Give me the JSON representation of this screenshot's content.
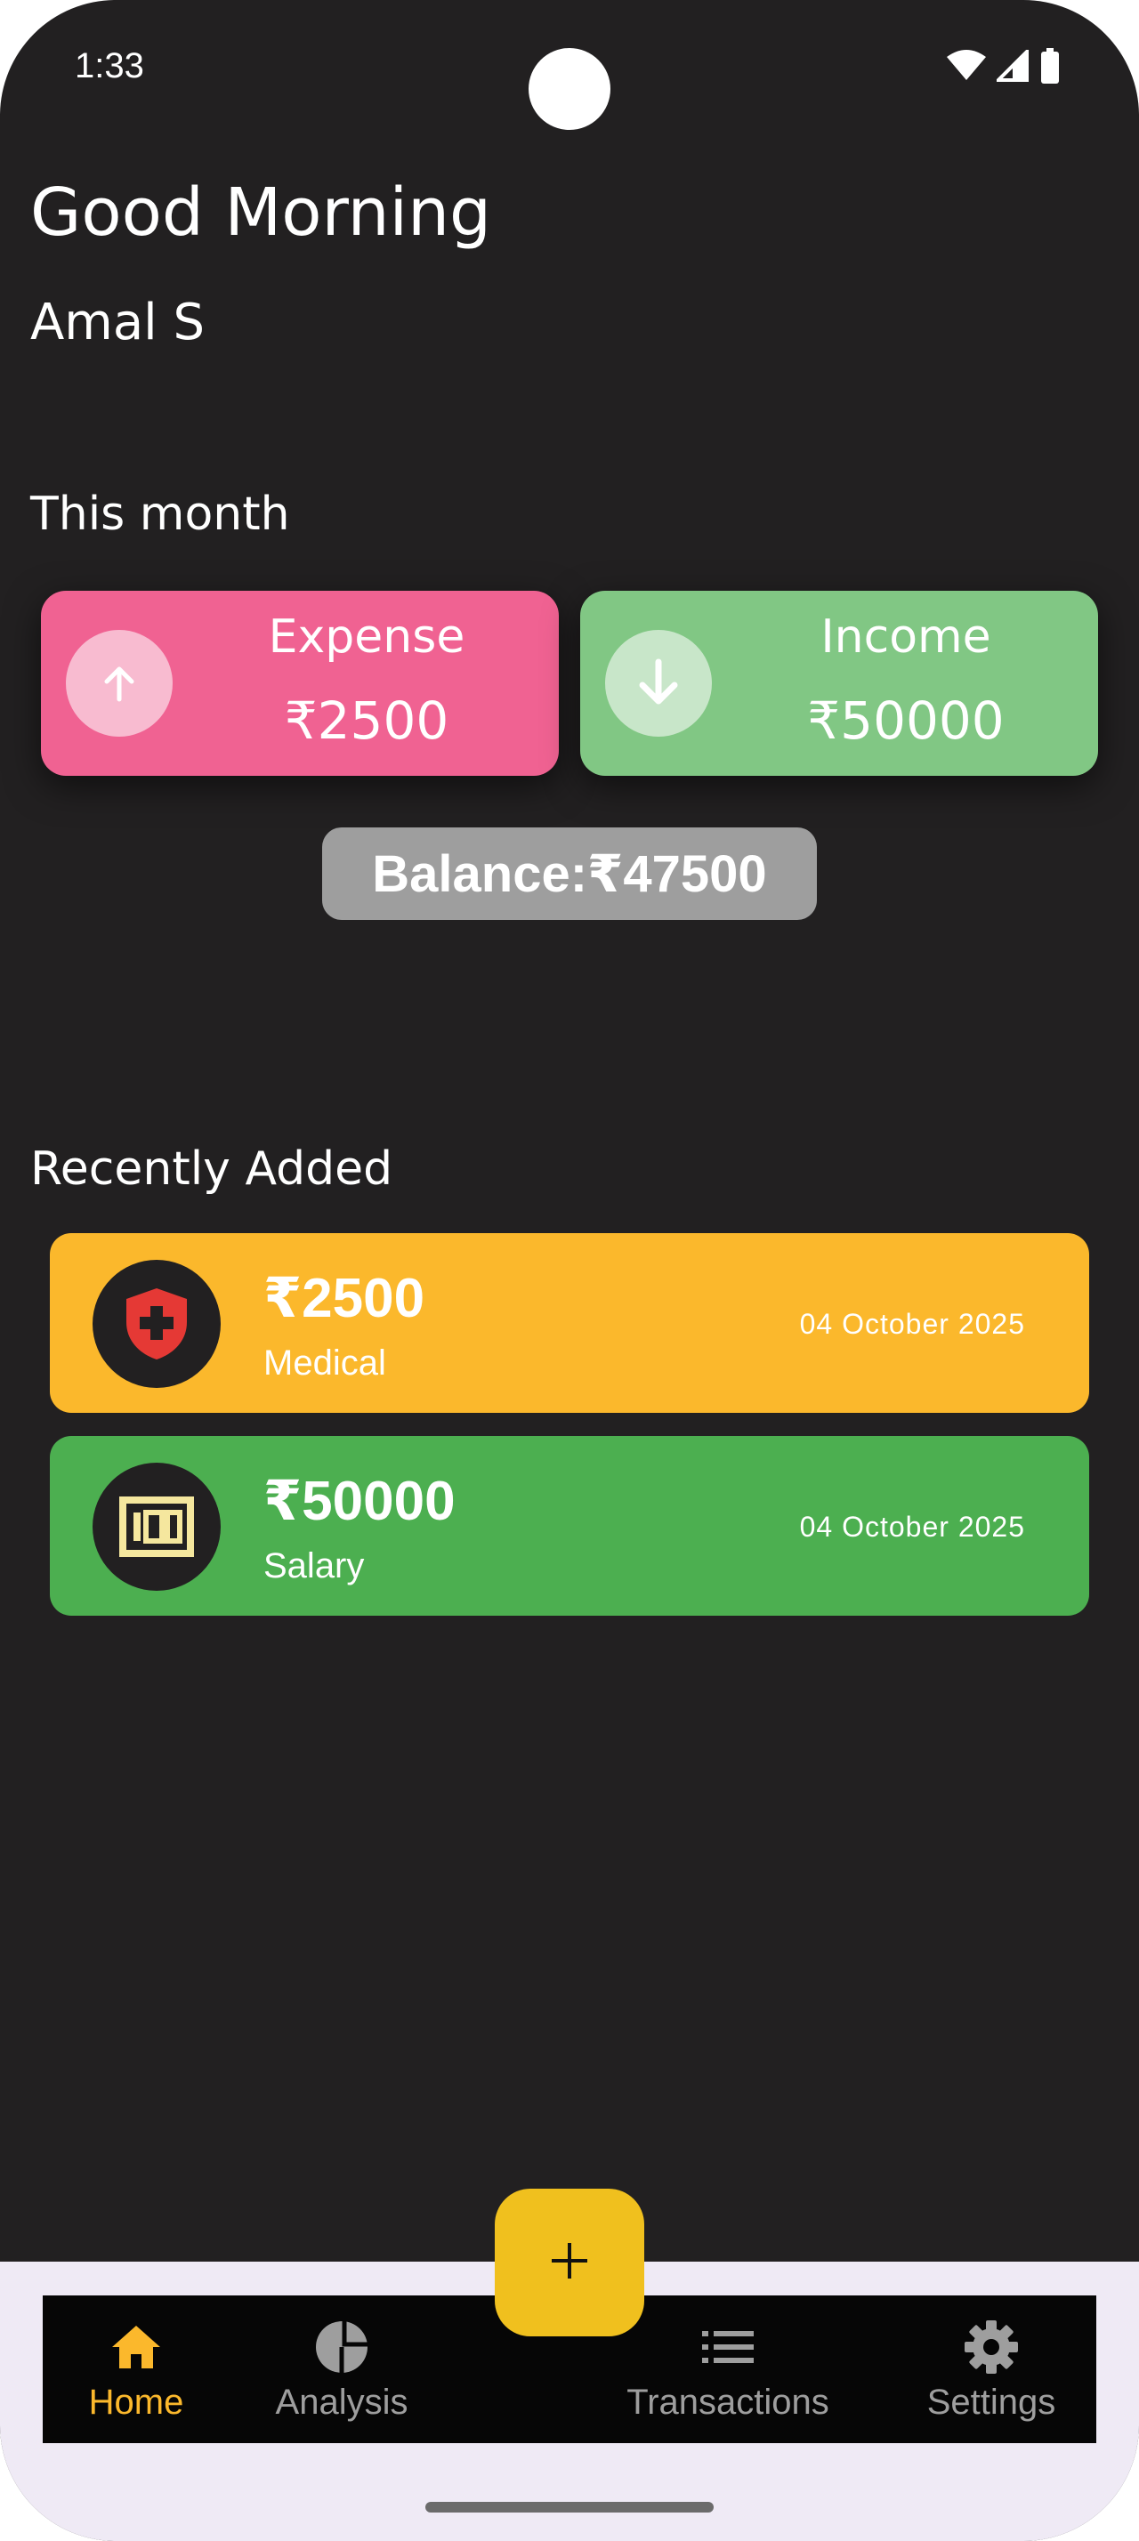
{
  "status_bar": {
    "time": "1:33"
  },
  "header": {
    "greeting": "Good Morning",
    "user_name": "Amal S"
  },
  "summary": {
    "title": "This month",
    "expense": {
      "label": "Expense",
      "amount": "₹2500",
      "icon": "arrow-up-icon",
      "color": "#f06292"
    },
    "income": {
      "label": "Income",
      "amount": "₹50000",
      "icon": "arrow-down-icon",
      "color": "#81c784"
    },
    "balance": "Balance:₹47500"
  },
  "recent": {
    "title": "Recently Added",
    "items": [
      {
        "amount": "₹2500",
        "category": "Medical",
        "date": "04 October 2025",
        "icon": "medical-shield-icon",
        "color": "#fbb82c"
      },
      {
        "amount": "₹50000",
        "category": "Salary",
        "date": "04 October 2025",
        "icon": "banknote-icon",
        "color": "#4caf50"
      }
    ]
  },
  "fab": {
    "icon": "plus-icon"
  },
  "nav": {
    "items": [
      {
        "label": "Home",
        "icon": "home-icon",
        "active": true
      },
      {
        "label": "Analysis",
        "icon": "pie-chart-icon",
        "active": false
      },
      {
        "label": "Transactions",
        "icon": "list-icon",
        "active": false
      },
      {
        "label": "Settings",
        "icon": "gear-icon",
        "active": false
      }
    ],
    "active_color": "#fbb82c"
  }
}
